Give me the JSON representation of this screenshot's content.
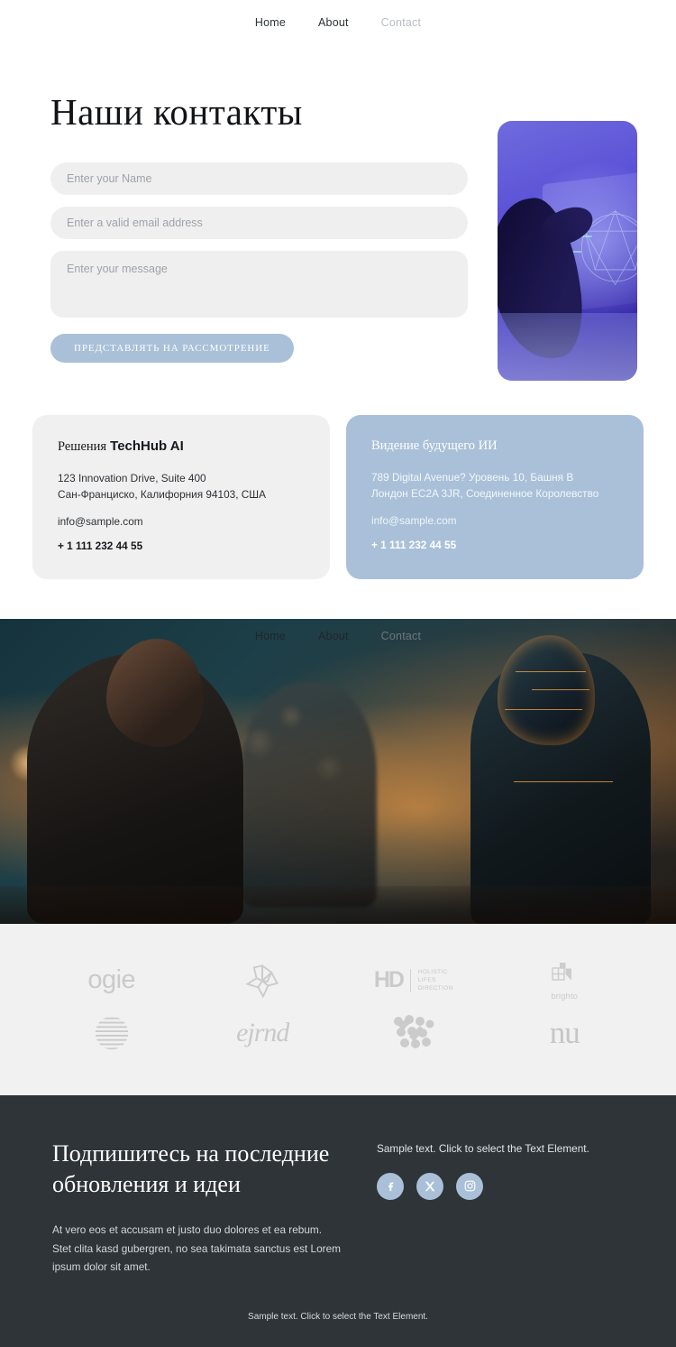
{
  "nav": {
    "items": [
      {
        "label": "Home",
        "muted": false
      },
      {
        "label": "About",
        "muted": false
      },
      {
        "label": "Contact",
        "muted": true
      }
    ]
  },
  "contact": {
    "title": "Наши контакты",
    "fields": {
      "name_placeholder": "Enter your Name",
      "email_placeholder": "Enter a valid email address",
      "message_placeholder": "Enter your message"
    },
    "submit_label": "ПРЕДСТАВЛЯТЬ НА РАССМОТРЕНИЕ",
    "side_image_alt": "hand-touching-hologram-image"
  },
  "cards": [
    {
      "title_serif": "Решения",
      "title_bold": "TechHub AI",
      "address_line1": "123 Innovation Drive, Suite 400",
      "address_line2": "Сан-Франциско, Калифорния 94103, США",
      "email": "info@sample.com",
      "phone": "+ 1 111 232 44 55"
    },
    {
      "title": "Видение будущего ИИ",
      "address_line1": "789 Digital Avenue? Уровень 10, Башня В",
      "address_line2": "Лондон EC2A 3JR, Соединенное Королевство",
      "email": "info@sample.com",
      "phone": "+ 1 111 232 44 55"
    }
  ],
  "hero": {
    "image_alt": "woman-with-robot-at-keyboard-image",
    "nav": [
      {
        "label": "Home",
        "muted": false
      },
      {
        "label": "About",
        "muted": false
      },
      {
        "label": "Contact",
        "muted": true
      }
    ]
  },
  "logos": {
    "row1": [
      {
        "name": "ogie",
        "type": "wordmark"
      },
      {
        "name": "flower-mark",
        "type": "icon"
      },
      {
        "name": "HD",
        "sub_line1": "HOLISTIC",
        "sub_line2": "LIFES",
        "sub_line3": "DIRECTION",
        "type": "hd"
      },
      {
        "name": "brighto",
        "type": "brighto"
      }
    ],
    "row2": [
      {
        "name": "striped-globe",
        "type": "icon"
      },
      {
        "name": "ejrnd",
        "type": "script"
      },
      {
        "name": "dot-grid-mark",
        "type": "icon"
      },
      {
        "name": "nu",
        "type": "serif-word"
      }
    ]
  },
  "footer": {
    "title": "Подпишитесь на последние обновления и идеи",
    "body": "At vero eos et accusam et justo duo dolores et ea rebum. Stet clita kasd gubergren, no sea takimata sanctus est Lorem ipsum dolor sit amet.",
    "sample_text": "Sample text. Click to select the Text Element.",
    "socials": [
      {
        "name": "facebook",
        "glyph": "f"
      },
      {
        "name": "x-twitter",
        "glyph": "X"
      },
      {
        "name": "instagram",
        "glyph": "◎"
      }
    ],
    "bottom_text": "Sample text. Click to select the Text Element."
  },
  "colors": {
    "accent_blue": "#a9c0d8",
    "footer_bg": "#2e3438",
    "field_bg": "#efeff0",
    "logo_strip_bg": "#f1f1f1"
  }
}
